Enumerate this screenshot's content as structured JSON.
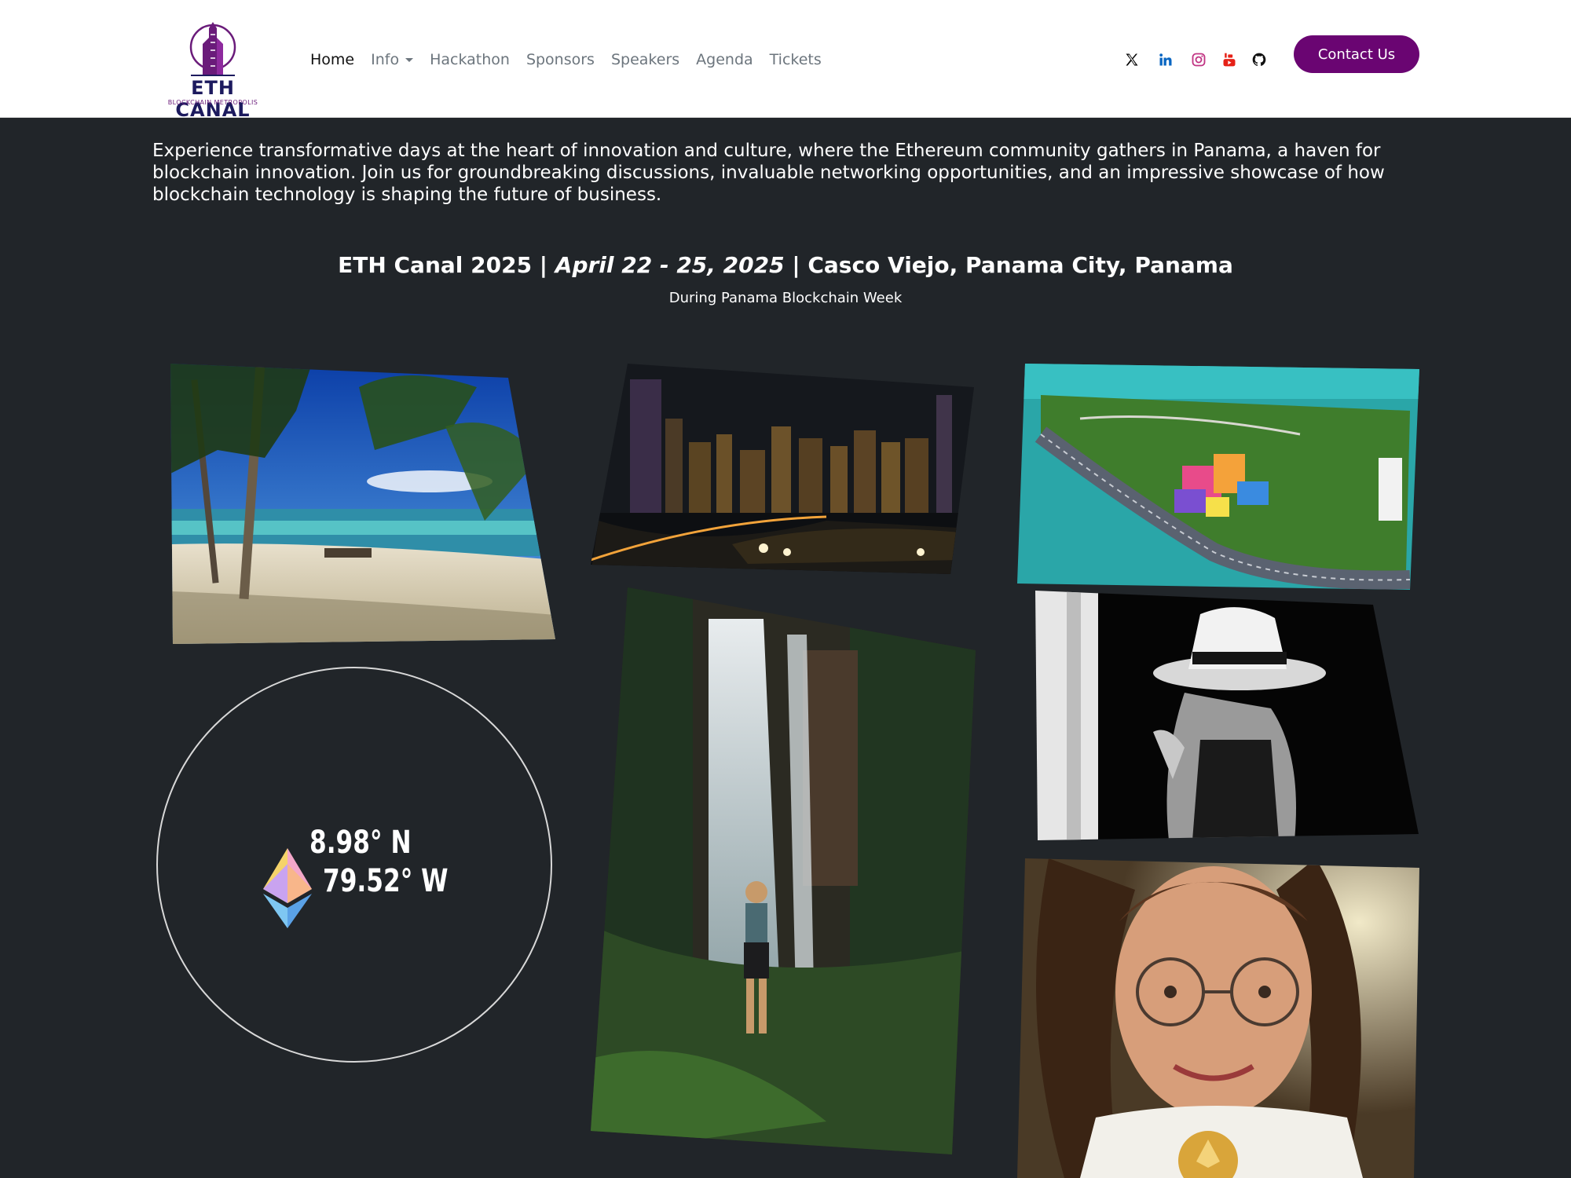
{
  "brand": {
    "name": "ETH CANAL",
    "tagline": "BLOCKCHAIN METROPOLIS"
  },
  "nav": {
    "items": [
      {
        "label": "Home",
        "active": true
      },
      {
        "label": "Info",
        "dropdown": true
      },
      {
        "label": "Hackathon"
      },
      {
        "label": "Sponsors"
      },
      {
        "label": "Speakers"
      },
      {
        "label": "Agenda"
      },
      {
        "label": "Tickets"
      }
    ],
    "social": [
      {
        "icon": "x-twitter-icon",
        "color": "#000000"
      },
      {
        "icon": "linkedin-icon",
        "color": "#0a66c2"
      },
      {
        "icon": "instagram-icon",
        "color": "#c13584"
      },
      {
        "icon": "youtube-icon",
        "color": "#e62117"
      },
      {
        "icon": "github-icon",
        "color": "#111111"
      }
    ],
    "contact_label": "Contact Us"
  },
  "intro": {
    "text": "Experience transformative days at the heart of innovation and culture, where the Ethereum community gathers in Panama, a haven for blockchain innovation. Join us for groundbreaking discussions, invaluable networking opportunities, and an impressive showcase of how blockchain technology is shaping the future of business."
  },
  "event": {
    "name": "ETH Canal 2025 |",
    "dates": "April 22 - 25, 2025",
    "location": "| Casco Viejo, Panama City, Panama",
    "subtitle": "During Panama Blockchain Week"
  },
  "coordinates": {
    "lat": "8.98°  N",
    "lon": "79.52° W"
  },
  "gallery": [
    {
      "name": "beach-palms-photo"
    },
    {
      "name": "city-skyline-night-photo"
    },
    {
      "name": "aerial-biomuseo-photo"
    },
    {
      "name": "waterfall-hiker-photo"
    },
    {
      "name": "woman-hat-bw-photo"
    },
    {
      "name": "woman-eth-coin-photo"
    }
  ],
  "colors": {
    "background": "#212529",
    "navbar": "#ffffff",
    "accent": "#6a0572",
    "text": "#ffffff"
  }
}
